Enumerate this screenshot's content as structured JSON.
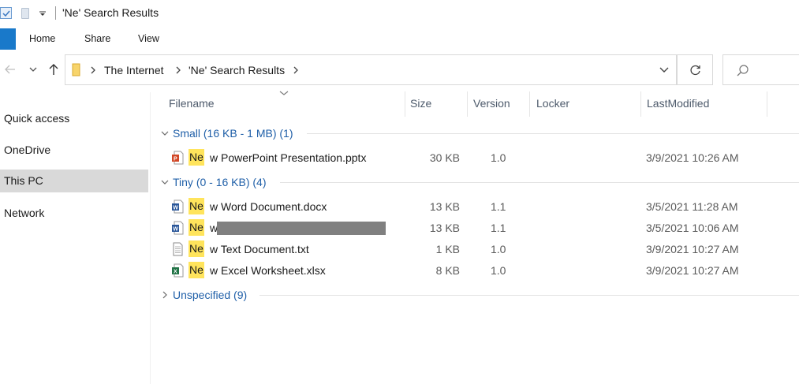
{
  "window": {
    "title": "'Ne' Search Results"
  },
  "ribbon": {
    "tabs": [
      "Home",
      "Share",
      "View"
    ]
  },
  "address": {
    "crumbs": [
      "The Internet",
      "'Ne' Search Results"
    ]
  },
  "nav_pane": {
    "items": [
      "Quick access",
      "OneDrive",
      "This PC",
      "Network"
    ],
    "selected": "This PC"
  },
  "columns": [
    "Filename",
    "Size",
    "Version",
    "Locker",
    "LastModified"
  ],
  "groups": [
    {
      "label": "Small (16 KB - 1 MB) (1)",
      "expanded": true,
      "files": [
        {
          "icon": "powerpoint-file-icon",
          "highlight": "Ne",
          "rest": "w PowerPoint Presentation.pptx",
          "size": "30 KB",
          "version": "1.0",
          "locker": "",
          "modified": "3/9/2021 10:26 AM"
        }
      ]
    },
    {
      "label": "Tiny (0 - 16 KB) (4)",
      "expanded": true,
      "files": [
        {
          "icon": "word-file-icon",
          "highlight": "Ne",
          "rest": "w Word Document.docx",
          "size": "13 KB",
          "version": "1.1",
          "locker": "",
          "modified": "3/5/2021 11:28 AM"
        },
        {
          "icon": "word-file-icon",
          "highlight": "Ne",
          "rest": "w",
          "redacted": true,
          "size": "13 KB",
          "version": "1.1",
          "locker": "",
          "modified": "3/5/2021 10:06 AM"
        },
        {
          "icon": "text-file-icon",
          "highlight": "Ne",
          "rest": "w Text Document.txt",
          "size": "1 KB",
          "version": "1.0",
          "locker": "",
          "modified": "3/9/2021 10:27 AM"
        },
        {
          "icon": "excel-file-icon",
          "highlight": "Ne",
          "rest": "w Excel Worksheet.xlsx",
          "size": "8 KB",
          "version": "1.0",
          "locker": "",
          "modified": "3/9/2021 10:27 AM"
        }
      ]
    },
    {
      "label": "Unspecified (9)",
      "expanded": false,
      "files": []
    }
  ],
  "colors": {
    "accent": "#1979ca",
    "group_text": "#1f5fa8",
    "highlight": "#ffe45c",
    "selection": "#d9d9d9"
  }
}
